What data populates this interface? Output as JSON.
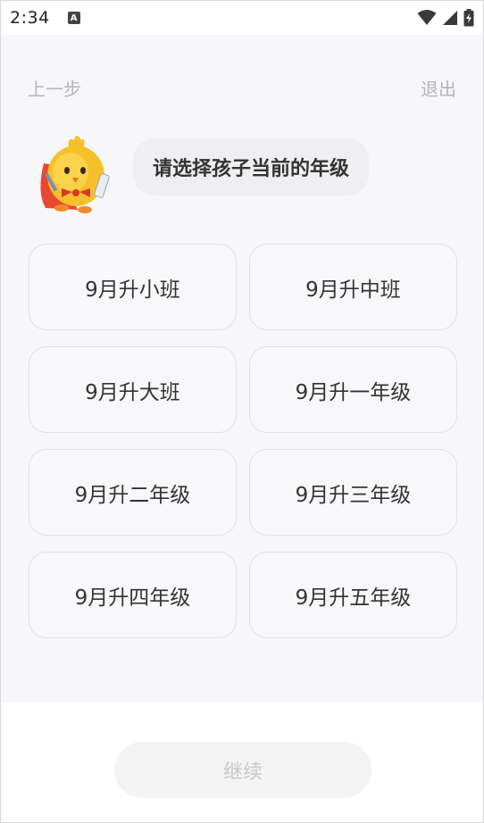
{
  "status_bar": {
    "time": "2:34",
    "app_icon_letter": "A"
  },
  "nav": {
    "back_label": "上一步",
    "exit_label": "退出"
  },
  "prompt": {
    "question": "请选择孩子当前的年级"
  },
  "grades": [
    {
      "label": "9月升小班"
    },
    {
      "label": "9月升中班"
    },
    {
      "label": "9月升大班"
    },
    {
      "label": "9月升一年级"
    },
    {
      "label": "9月升二年级"
    },
    {
      "label": "9月升三年级"
    },
    {
      "label": "9月升四年级"
    },
    {
      "label": "9月升五年级"
    }
  ],
  "footer": {
    "continue_label": "继续"
  },
  "colors": {
    "background": "#f7f7f9",
    "option_border": "#e2e2e6",
    "disabled_button": "#f3f3f3",
    "disabled_text": "#c8c8c8",
    "mascot_body": "#f6c02b",
    "mascot_cape": "#e8482f"
  },
  "icons": {
    "status": [
      "app-notification-icon",
      "wifi-icon",
      "signal-icon",
      "battery-icon"
    ],
    "mascot": "chick-mascot-icon"
  }
}
